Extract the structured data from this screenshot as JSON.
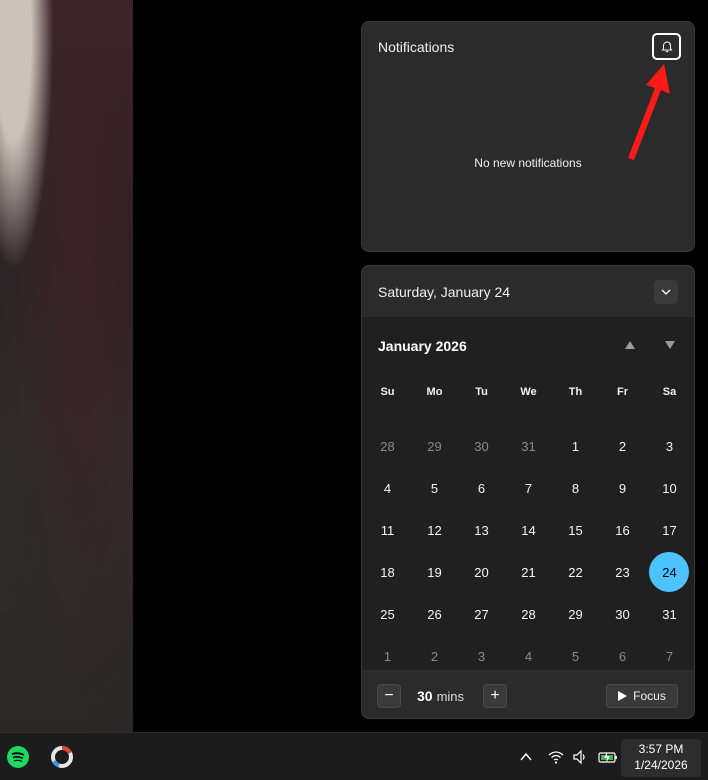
{
  "notifications": {
    "title": "Notifications",
    "empty_message": "No new notifications",
    "dnd_icon": "bell-snooze-icon"
  },
  "calendar": {
    "date_title": "Saturday, January 24",
    "month_title": "January 2026",
    "weekdays": [
      "Su",
      "Mo",
      "Tu",
      "We",
      "Th",
      "Fr",
      "Sa"
    ],
    "weeks": [
      [
        {
          "d": "28",
          "m": true
        },
        {
          "d": "29",
          "m": true
        },
        {
          "d": "30",
          "m": true
        },
        {
          "d": "31",
          "m": true
        },
        {
          "d": "1"
        },
        {
          "d": "2"
        },
        {
          "d": "3"
        }
      ],
      [
        {
          "d": "4"
        },
        {
          "d": "5"
        },
        {
          "d": "6"
        },
        {
          "d": "7"
        },
        {
          "d": "8"
        },
        {
          "d": "9"
        },
        {
          "d": "10"
        }
      ],
      [
        {
          "d": "11"
        },
        {
          "d": "12"
        },
        {
          "d": "13"
        },
        {
          "d": "14"
        },
        {
          "d": "15"
        },
        {
          "d": "16"
        },
        {
          "d": "17"
        }
      ],
      [
        {
          "d": "18"
        },
        {
          "d": "19"
        },
        {
          "d": "20"
        },
        {
          "d": "21"
        },
        {
          "d": "22"
        },
        {
          "d": "23"
        },
        {
          "d": "24",
          "today": true
        }
      ],
      [
        {
          "d": "25"
        },
        {
          "d": "26"
        },
        {
          "d": "27"
        },
        {
          "d": "28"
        },
        {
          "d": "29"
        },
        {
          "d": "30"
        },
        {
          "d": "31"
        }
      ],
      [
        {
          "d": "1",
          "m": true
        },
        {
          "d": "2",
          "m": true
        },
        {
          "d": "3",
          "m": true
        },
        {
          "d": "4",
          "m": true
        },
        {
          "d": "5",
          "m": true
        },
        {
          "d": "6",
          "m": true
        },
        {
          "d": "7",
          "m": true
        }
      ]
    ],
    "today_color": "#4cc2ff"
  },
  "focus": {
    "minus_label": "−",
    "plus_label": "+",
    "duration_value": "30",
    "duration_unit": "mins",
    "focus_label": "Focus"
  },
  "taskbar": {
    "apps": [
      "spotify-icon",
      "davinci-resolve-icon"
    ],
    "tray_icons": [
      "chevron-up-icon",
      "wifi-icon",
      "volume-icon",
      "battery-charging-icon"
    ],
    "time": "3:57 PM",
    "date": "1/24/2026"
  },
  "annotation": {
    "arrow_color": "#ff1a1a"
  }
}
